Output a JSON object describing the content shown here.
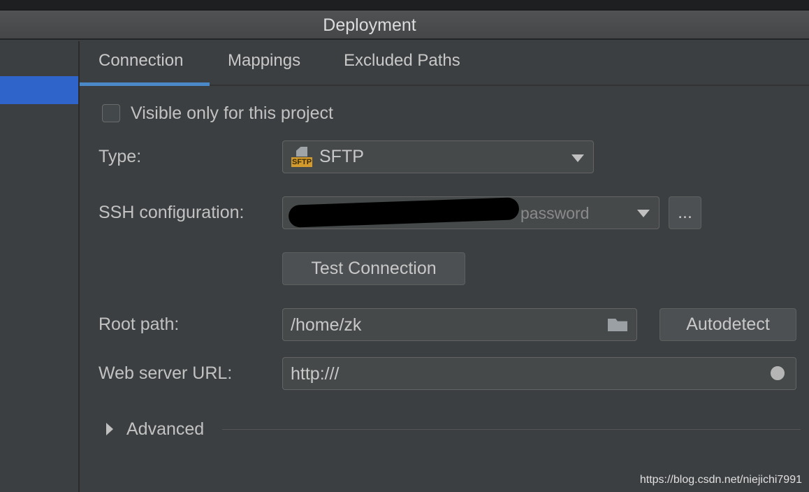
{
  "window": {
    "title": "Deployment"
  },
  "tabs": [
    {
      "label": "Connection",
      "active": true
    },
    {
      "label": "Mappings"
    },
    {
      "label": "Excluded Paths"
    }
  ],
  "form": {
    "visible_only_label": "Visible only for this project",
    "visible_only_checked": false,
    "type_label": "Type:",
    "type_value": "SFTP",
    "type_icon_text": "SFTP",
    "ssh_label": "SSH configuration:",
    "ssh_value_suffix": "password",
    "ssh_more": "...",
    "test_connection": "Test Connection",
    "root_label": "Root path:",
    "root_value": "/home/zk",
    "autodetect": "Autodetect",
    "web_label": "Web server URL:",
    "web_value": "http:///",
    "advanced": "Advanced"
  },
  "watermark": "https://blog.csdn.net/niejichi7991",
  "colors": {
    "accent": "#4a88c7",
    "selection": "#2f65ca",
    "sftp_icon": "#d39b2e"
  }
}
